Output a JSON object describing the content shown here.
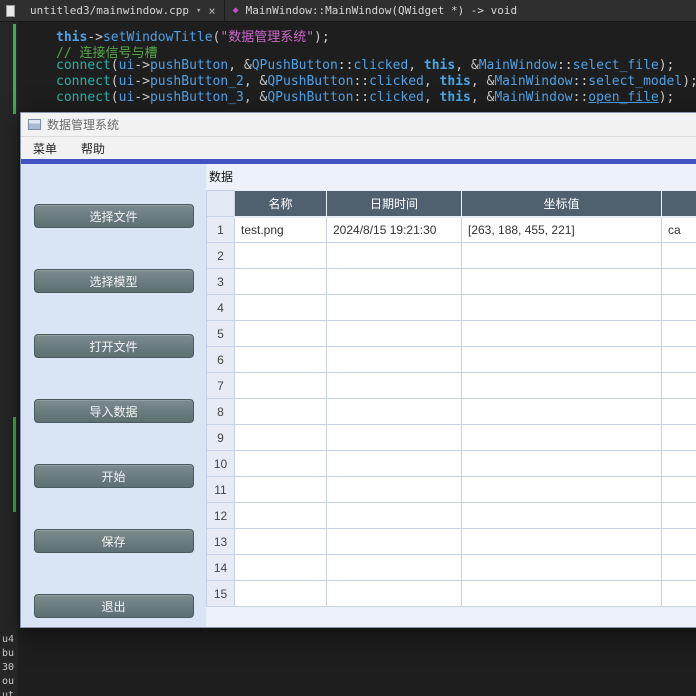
{
  "colors": {
    "accent_strip": "#4053c0",
    "table_header_bg": "#51606f",
    "button_bg": "#6e7f82",
    "marker_green": "#3fae4a"
  },
  "editor": {
    "tab_file": "untitled3/mainwindow.cpp",
    "tab_dropdown": "▾",
    "tab_close": "×",
    "symbol_icon": "◆",
    "tab_symbol": "MainWindow::MainWindow(QWidget *) -> void",
    "code_lines": [
      {
        "tokens": [
          {
            "t": "this",
            "c": "kw"
          },
          {
            "t": "->",
            "c": "pln"
          },
          {
            "t": "setWindowTitle",
            "c": "blue"
          },
          {
            "t": "(",
            "c": "pln"
          },
          {
            "t": "\"数据管理系统\"",
            "c": "str"
          },
          {
            "t": ")",
            "c": "pln"
          },
          {
            "t": ";",
            "c": "pln"
          }
        ]
      },
      {
        "tokens": [
          {
            "t": "// 连接信号与槽",
            "c": "cmt"
          }
        ]
      },
      {
        "tokens": [
          {
            "t": "connect",
            "c": "teal"
          },
          {
            "t": "(",
            "c": "pln"
          },
          {
            "t": "ui",
            "c": "blue"
          },
          {
            "t": "->",
            "c": "pln"
          },
          {
            "t": "pushButton",
            "c": "blue"
          },
          {
            "t": ", ",
            "c": "pln"
          },
          {
            "t": "&",
            "c": "pln"
          },
          {
            "t": "QPushButton",
            "c": "blue"
          },
          {
            "t": "::",
            "c": "pln"
          },
          {
            "t": "clicked",
            "c": "blue"
          },
          {
            "t": ", ",
            "c": "pln"
          },
          {
            "t": "this",
            "c": "kw"
          },
          {
            "t": ", ",
            "c": "pln"
          },
          {
            "t": "&",
            "c": "pln"
          },
          {
            "t": "MainWindow",
            "c": "blue"
          },
          {
            "t": "::",
            "c": "pln"
          },
          {
            "t": "select_file",
            "c": "blue"
          },
          {
            "t": ");",
            "c": "pln"
          }
        ]
      },
      {
        "tokens": [
          {
            "t": "connect",
            "c": "teal"
          },
          {
            "t": "(",
            "c": "pln"
          },
          {
            "t": "ui",
            "c": "blue"
          },
          {
            "t": "->",
            "c": "pln"
          },
          {
            "t": "pushButton_2",
            "c": "blue"
          },
          {
            "t": ", ",
            "c": "pln"
          },
          {
            "t": "&",
            "c": "pln"
          },
          {
            "t": "QPushButton",
            "c": "blue"
          },
          {
            "t": "::",
            "c": "pln"
          },
          {
            "t": "clicked",
            "c": "blue"
          },
          {
            "t": ", ",
            "c": "pln"
          },
          {
            "t": "this",
            "c": "kw"
          },
          {
            "t": ", ",
            "c": "pln"
          },
          {
            "t": "&",
            "c": "pln"
          },
          {
            "t": "MainWindow",
            "c": "blue"
          },
          {
            "t": "::",
            "c": "pln"
          },
          {
            "t": "select_model",
            "c": "blue"
          },
          {
            "t": ");",
            "c": "pln"
          }
        ]
      },
      {
        "tokens": [
          {
            "t": "connect",
            "c": "teal"
          },
          {
            "t": "(",
            "c": "pln"
          },
          {
            "t": "ui",
            "c": "blue"
          },
          {
            "t": "->",
            "c": "pln"
          },
          {
            "t": "pushButton_3",
            "c": "blue"
          },
          {
            "t": ", ",
            "c": "pln"
          },
          {
            "t": "&",
            "c": "pln"
          },
          {
            "t": "QPushButton",
            "c": "blue"
          },
          {
            "t": "::",
            "c": "pln"
          },
          {
            "t": "clicked",
            "c": "blue"
          },
          {
            "t": ", ",
            "c": "pln"
          },
          {
            "t": "this",
            "c": "kw"
          },
          {
            "t": ", ",
            "c": "pln"
          },
          {
            "t": "&",
            "c": "pln"
          },
          {
            "t": "MainWindow",
            "c": "blue"
          },
          {
            "t": "::",
            "c": "pln"
          },
          {
            "t": "open_file",
            "c": "link"
          },
          {
            "t": ");",
            "c": "pln"
          }
        ]
      }
    ],
    "bottom_fragments": [
      "u4",
      "bu",
      "30",
      "ou",
      "ut"
    ]
  },
  "window": {
    "title": "数据管理系统",
    "menus": [
      {
        "label": "菜单",
        "name": "menu-item-menu"
      },
      {
        "label": "帮助",
        "name": "menu-item-help"
      }
    ],
    "buttons": [
      {
        "label": "选择文件",
        "name": "select-file-button"
      },
      {
        "label": "选择模型",
        "name": "select-model-button"
      },
      {
        "label": "打开文件",
        "name": "open-file-button"
      },
      {
        "label": "导入数据",
        "name": "import-data-button"
      },
      {
        "label": "开始",
        "name": "start-button"
      },
      {
        "label": "保存",
        "name": "save-button"
      },
      {
        "label": "退出",
        "name": "exit-button"
      }
    ],
    "data_label": "数据",
    "table": {
      "headers": [
        "名称",
        "日期时间",
        "坐标值",
        ""
      ],
      "row_numbers": [
        "1",
        "2",
        "3",
        "4",
        "5",
        "6",
        "7",
        "8",
        "9",
        "10",
        "11",
        "12",
        "13",
        "14",
        "15"
      ],
      "rows": [
        [
          "test.png",
          "2024/8/15 19:21:30",
          "[263, 188, 455, 221]",
          "ca"
        ]
      ]
    }
  }
}
